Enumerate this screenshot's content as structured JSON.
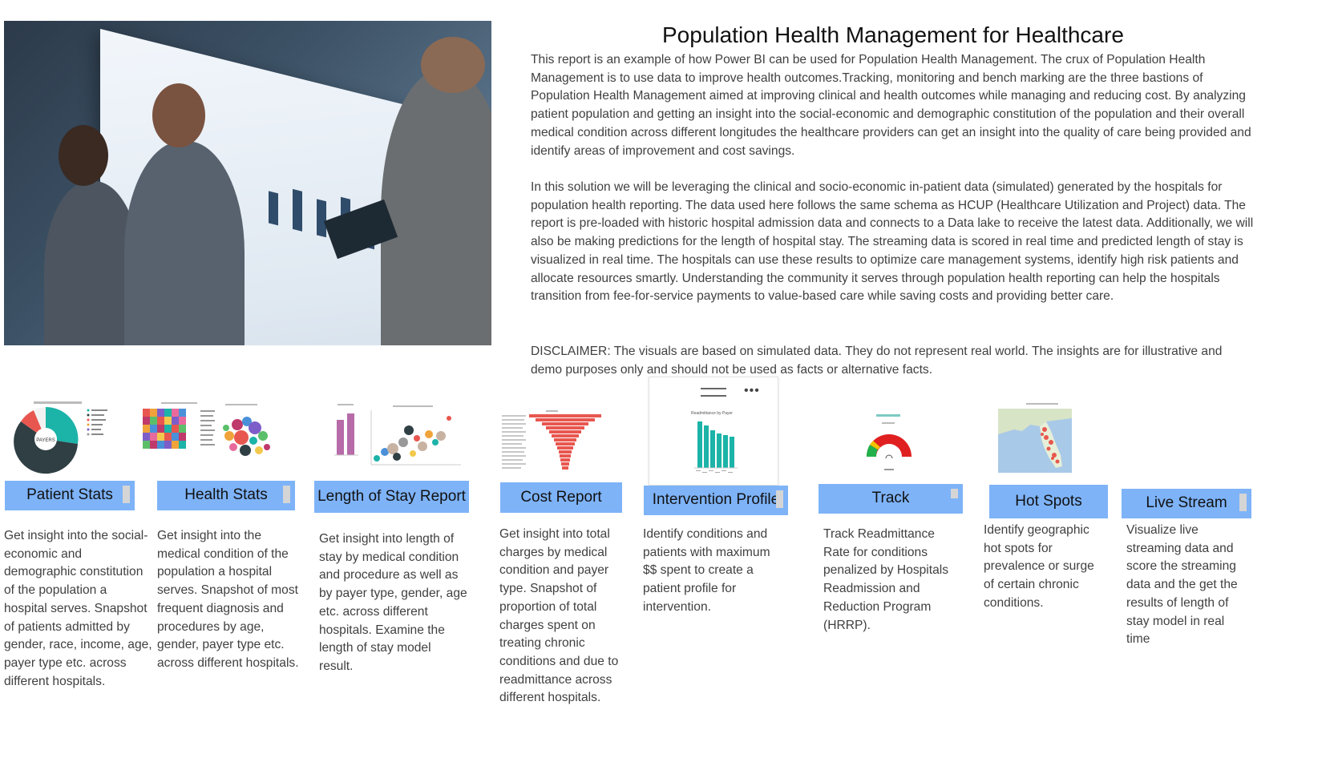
{
  "report": {
    "title": "Population Health Management for Healthcare",
    "paragraphs": [
      "This report is an example of how Power BI can be used for Population Health Management. The crux of Population Health Management is to use data to improve health outcomes.Tracking, monitoring and bench marking are the three bastions of Population Health Management aimed at improving clinical and health outcomes while managing and reducing cost. By analyzing patient population and getting an insight into the social-economic and demographic constitution of the population and their overall medical condition across different longitudes the healthcare providers can get an insight into the quality of care being provided and identify areas of improvement and cost savings.",
      "In this solution we will be leveraging the clinical and socio-economic in-patient data (simulated) generated by the hospitals for population health reporting. The data used here follows the same schema as HCUP (Healthcare Utilization and Project) data. The report is pre-loaded with historic hospital admission data and connects to a Data lake to receive the latest data. Additionally, we will also be making predictions for the length of hospital stay. The streaming data is scored in real time and predicted length of stay is visualized in real time.  The hospitals can use these results to optimize care management systems, identify high risk patients and allocate resources smartly. Understanding the community it serves through population health reporting can help the hospitals transition from fee-for-service payments to value-based care while saving costs and providing better care.",
      "DISCLAIMER: The visuals are based on simulated data. They do not represent real world. The insights are for illustrative and demo purposes only and should not be used as facts or alternative facts."
    ]
  },
  "tiles": [
    {
      "label": "Patient Stats",
      "description": "Get insight into the social-economic and demographic constitution of the population a hospital serves. Snapshot of patients admitted by gender, race, income, age, payer type etc. across different hospitals."
    },
    {
      "label": "Health Stats",
      "description": "Get insight into the medical condition of the population a hospital serves. Snapshot of most frequent diagnosis and procedures by age, gender, payer type etc. across different hospitals."
    },
    {
      "label": "Length of Stay Report",
      "description": "Get insight into length of stay by medical condition and procedure as well as by payer type, gender, age etc. across different hospitals. Examine the length of stay model result."
    },
    {
      "label": "Cost Report",
      "description": "Get insight into total charges by medical condition and payer type. Snapshot of proportion of total charges spent on treating chronic conditions and due to readmittance across different hospitals."
    },
    {
      "label": "Intervention Profile",
      "description": "Identify conditions and patients with maximum $$ spent to create a patient profile for intervention."
    },
    {
      "label": "Track",
      "description": "Track Readmittance Rate for conditions penalized by Hospitals Readmission and Reduction Program (HRRP)."
    },
    {
      "label": "Hot Spots",
      "description": "Identify geographic hot spots for prevalence or surge of certain chronic conditions."
    },
    {
      "label": "Live Stream",
      "description": "Visualize live streaming data and score the streaming data and the get the results of length of stay model in real time"
    }
  ],
  "thumbnails": {
    "patient_stats_center": "PAYERS",
    "intervention_title": "Readmittance by Payer"
  },
  "colors": {
    "tile_button": "#7eb3f8",
    "teal": "#1cb3a8",
    "dark": "#2f3f44",
    "red": "#e8574f"
  }
}
